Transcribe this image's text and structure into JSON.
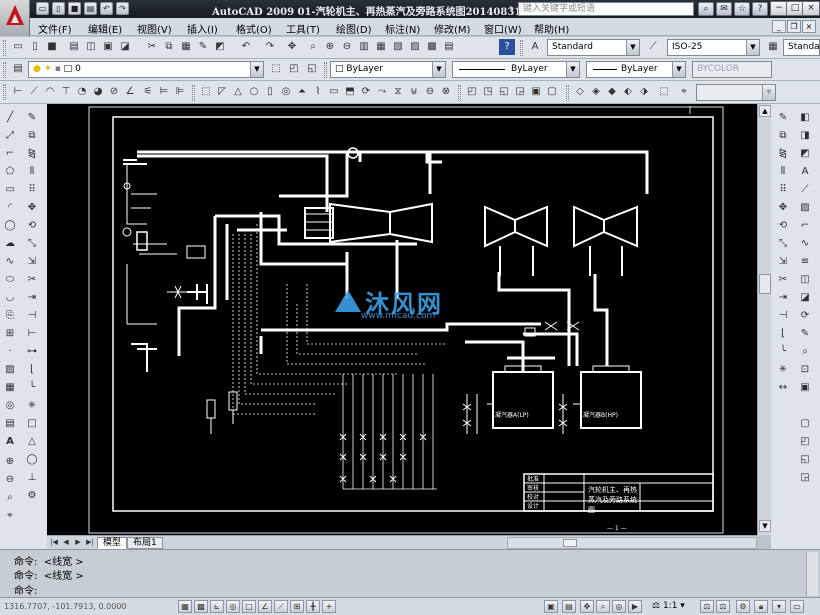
{
  "window": {
    "title": "AutoCAD 2009  01-汽轮机主、再热蒸汽及旁路系统图20140831",
    "search_placeholder": "键入关键字或短语",
    "controls": [
      "−",
      "□",
      "×"
    ]
  },
  "menu": {
    "items": [
      "文件(F)",
      "编辑(E)",
      "视图(V)",
      "插入(I)",
      "格式(O)",
      "工具(T)",
      "绘图(D)",
      "标注(N)",
      "修改(M)",
      "窗口(W)",
      "帮助(H)"
    ]
  },
  "standard_toolbar": {
    "text_style": "Standard",
    "dim_style": "ISO-25",
    "table_style": "Standar"
  },
  "layers_toolbar": {
    "current_layer": "0",
    "color": "ByLayer",
    "linetype": "ByLayer",
    "lineweight": "ByLayer",
    "plot_style": "BYCOLOR"
  },
  "drawing": {
    "watermark_cn": "沐风网",
    "watermark_url": "www.mfcad.com",
    "title_block_name": "汽轮机主、再热蒸汽及旁路系统图",
    "title_block_rows": [
      "批准",
      "审核",
      "校对",
      "设计"
    ],
    "page_mark": "— 1 —",
    "condenser_a": "凝汽器A(LP)",
    "condenser_b": "凝汽器B(HP)"
  },
  "tabs": {
    "items": [
      "模型",
      "布局1"
    ],
    "active": "模型"
  },
  "command": {
    "lines": [
      {
        "prompt": "命令:",
        "text": "<线宽 >"
      },
      {
        "prompt": "命令:",
        "text": "<线宽 >"
      },
      {
        "prompt": "命令:",
        "text": ""
      }
    ]
  },
  "status": {
    "coordinates": "1316.7707, -101.7913, 0.0000",
    "annotation_scale": "1:1"
  },
  "colors": {
    "canvas": "#000000",
    "lines": "#ffffff",
    "watermark": "#3aa0e6"
  }
}
